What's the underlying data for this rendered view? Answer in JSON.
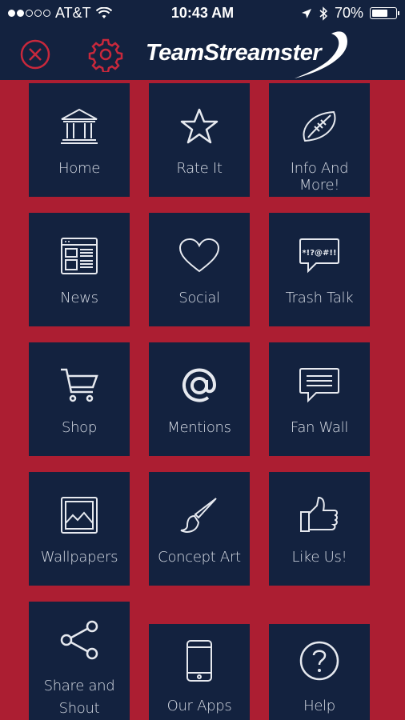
{
  "status_bar": {
    "carrier": "AT&T",
    "time": "10:43 AM",
    "battery": "70%",
    "battery_level": 0.7
  },
  "header": {
    "logo_text": "TeamStreamster"
  },
  "tiles": [
    {
      "label": "Home",
      "icon": "home-icon"
    },
    {
      "label": "Rate It",
      "icon": "star-icon"
    },
    {
      "label": "Info And More!",
      "icon": "football-icon"
    },
    {
      "label": "News",
      "icon": "newspaper-icon"
    },
    {
      "label": "Social",
      "icon": "heart-icon"
    },
    {
      "label": "Trash Talk",
      "icon": "speech-bubble-icon",
      "icon_text": "*!?@#!!"
    },
    {
      "label": "Shop",
      "icon": "shopping-cart-icon"
    },
    {
      "label": "Mentions",
      "icon": "at-sign-icon"
    },
    {
      "label": "Fan Wall",
      "icon": "message-icon"
    },
    {
      "label": "Wallpapers",
      "icon": "image-icon"
    },
    {
      "label": "Concept Art",
      "icon": "paintbrush-icon"
    },
    {
      "label": "Like Us!",
      "icon": "thumbs-up-icon"
    },
    {
      "label_line1": "Share and",
      "label_line2": "Shout",
      "icon": "share-icon"
    },
    {
      "label": "Our Apps",
      "icon": "phone-icon"
    },
    {
      "label": "Help",
      "icon": "help-icon"
    }
  ],
  "colors": {
    "background": "#ac1e32",
    "tile": "#13223f",
    "accent": "#c8283c"
  }
}
